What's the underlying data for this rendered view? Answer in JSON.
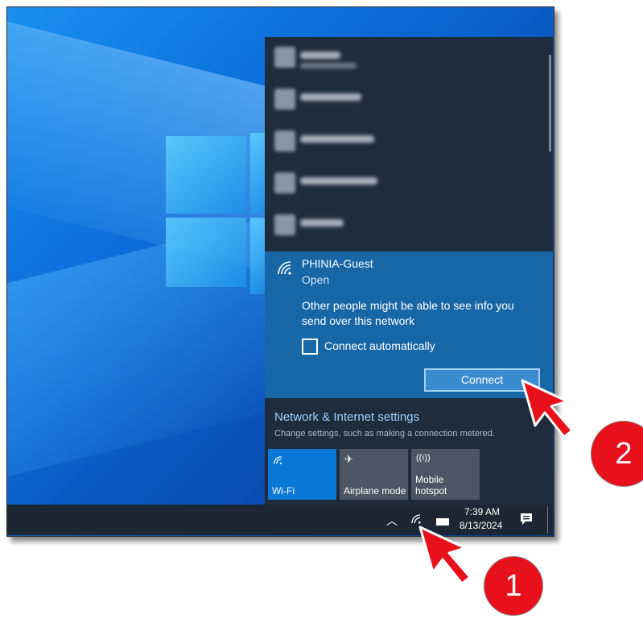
{
  "networks_blurred": [
    {
      "label": "PHINIA",
      "status": "Connected"
    },
    {
      "label": "GT-Aphasia"
    },
    {
      "label": "Yealink-93A050-5G"
    },
    {
      "label": "Yealink-93A2S2-5G"
    },
    {
      "label": "GT-Guest"
    }
  ],
  "selected_network": {
    "name": "PHINIA-Guest",
    "status": "Open",
    "warning": "Other people might be able to see info you send over this network",
    "auto_connect_label": "Connect automatically",
    "connect_label": "Connect"
  },
  "settings": {
    "title": "Network & Internet settings",
    "subtitle": "Change settings, such as making a connection metered."
  },
  "tiles": [
    {
      "label": "Wi-Fi",
      "icon": "wifi-icon",
      "active": true
    },
    {
      "label": "Airplane mode",
      "icon": "airplane-icon",
      "active": false
    },
    {
      "label": "Mobile hotspot",
      "icon": "hotspot-icon",
      "active": false
    }
  ],
  "taskbar": {
    "time": "7:39 AM",
    "date": "8/13/2024"
  },
  "annotations": {
    "step1": "1",
    "step2": "2"
  },
  "colors": {
    "accent": "#0078d7",
    "panel": "#1f2c3b",
    "selected": "#1766a6",
    "badge": "#e8101b"
  }
}
